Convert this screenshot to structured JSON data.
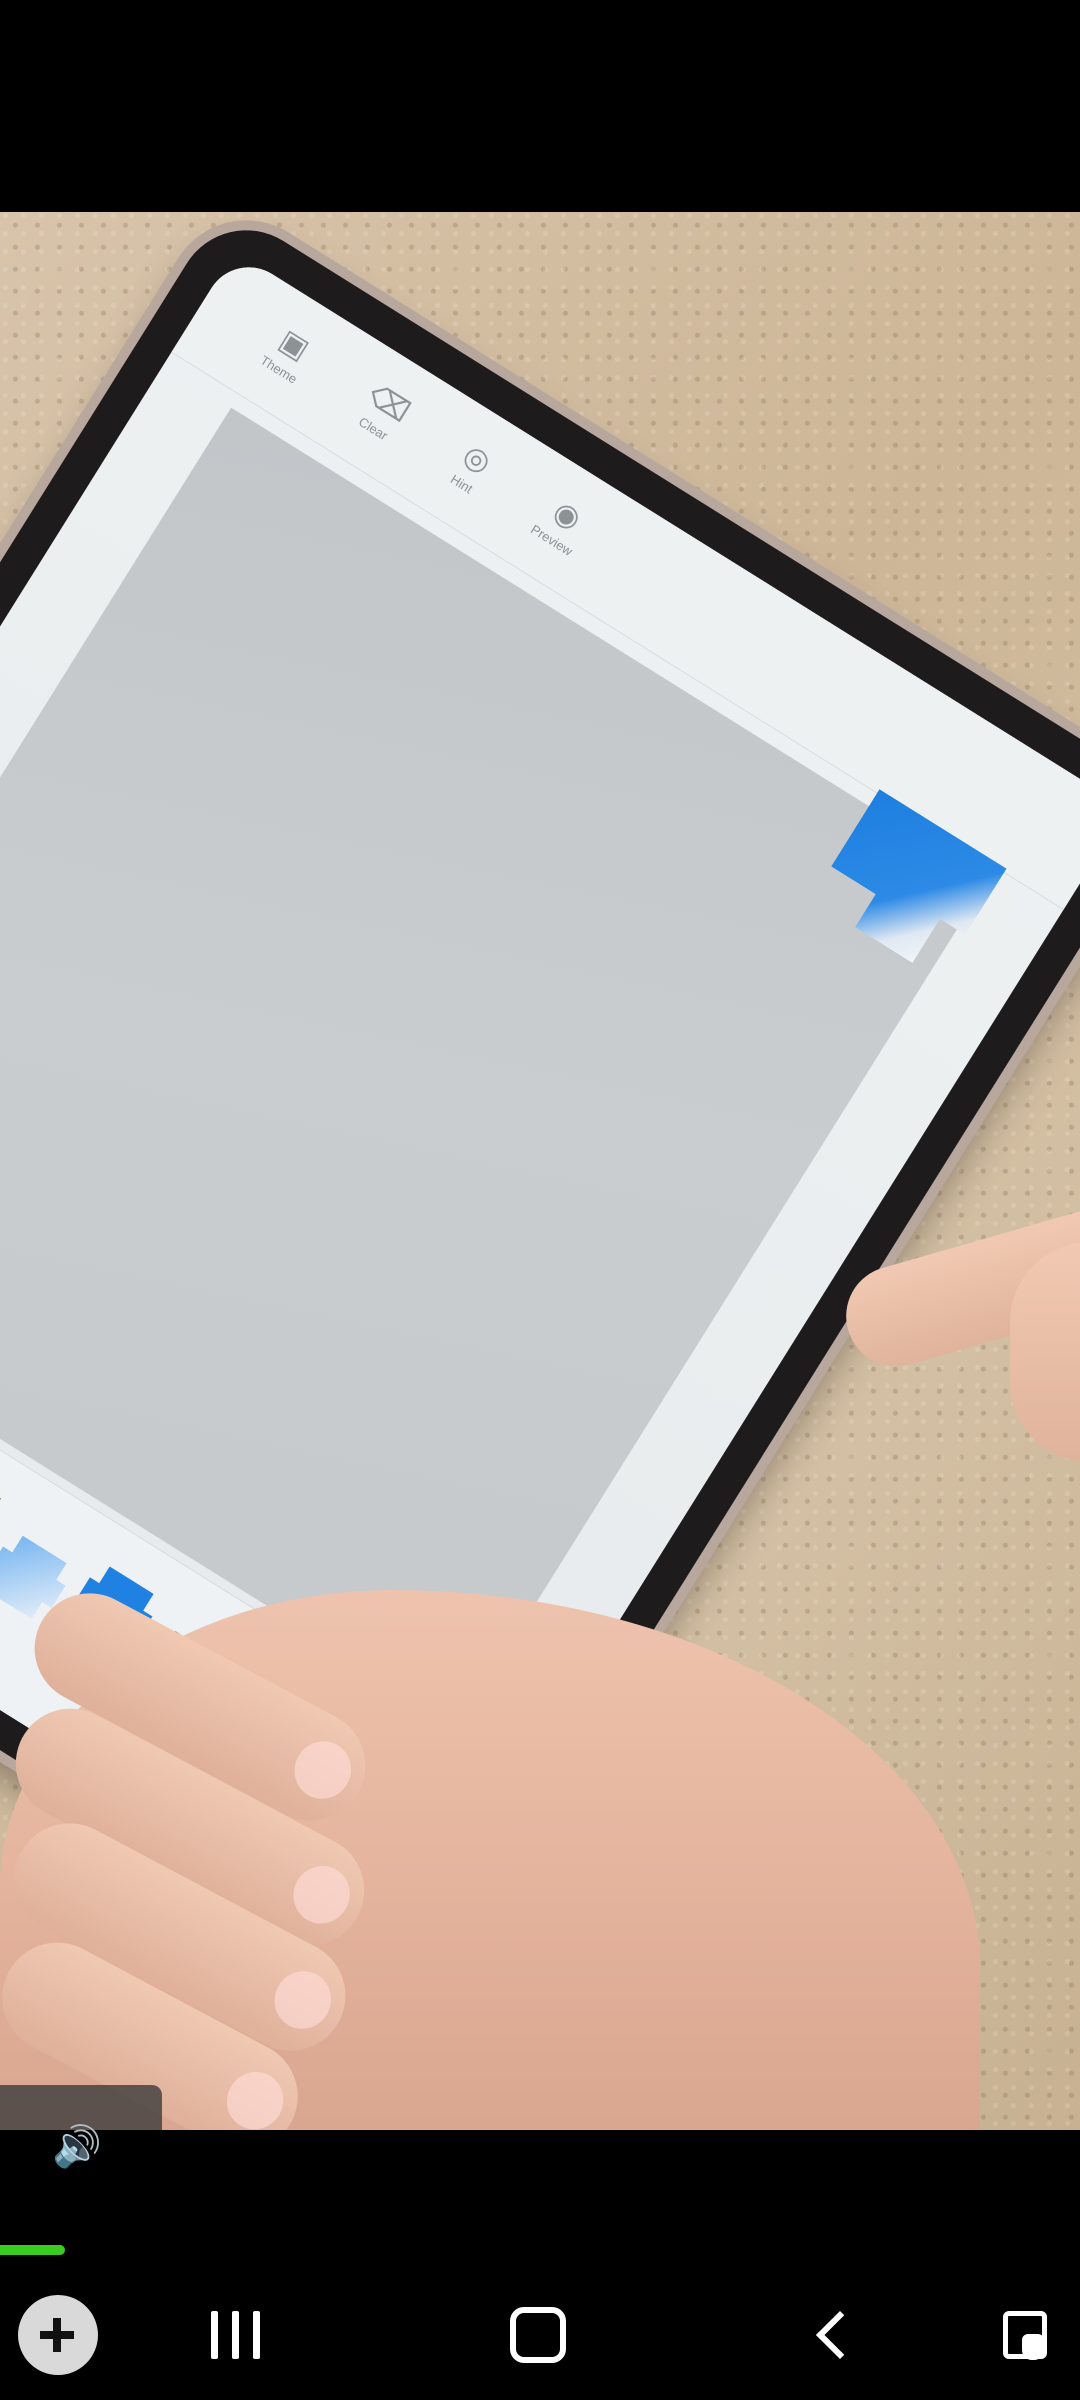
{
  "app": {
    "toolbar": {
      "items": [
        {
          "label": "Theme",
          "icon": "theme-icon"
        },
        {
          "label": "Clear",
          "icon": "clear-icon"
        },
        {
          "label": "Hint",
          "icon": "hint-icon"
        },
        {
          "label": "Preview",
          "icon": "preview-icon"
        }
      ]
    }
  },
  "player": {
    "progress": 0.06,
    "progress_color": "#3bcc21"
  },
  "navigation": {
    "buttons": [
      "game-launcher",
      "recent-apps",
      "home",
      "back",
      "assistant"
    ]
  }
}
